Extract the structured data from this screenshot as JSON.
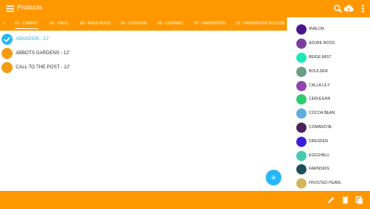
{
  "header": {
    "title": "Products"
  },
  "tabs": [
    {
      "label": "01 - CARPET",
      "active": true
    },
    {
      "label": "02 - VINYL"
    },
    {
      "label": "03 - AREA RUGS"
    },
    {
      "label": "04 - CUSHION"
    },
    {
      "label": "06 - CERAMIC"
    },
    {
      "label": "07 - HARDWOOD"
    },
    {
      "label": "07 - HARDWOOD ACCESS"
    }
  ],
  "products": [
    {
      "label": "ABANDON - 12'",
      "selected": true
    },
    {
      "label": "ABBOTS GARDENS - 12'"
    },
    {
      "label": "CALL TO THE POST - 12'"
    }
  ],
  "colors": [
    {
      "name": "AVALON",
      "hex": "#4a148c"
    },
    {
      "name": "AZURE MOSS",
      "hex": "#7b3fa0"
    },
    {
      "name": "BEIGE MIST",
      "hex": "#1de9b6"
    },
    {
      "name": "BOULDER",
      "hex": "#6b9e84"
    },
    {
      "name": "CALLA LILY",
      "hex": "#8e44ad"
    },
    {
      "name": "CERULEAN",
      "hex": "#2ecc71"
    },
    {
      "name": "COCOA BEAN",
      "hex": "#5dade2"
    },
    {
      "name": "COMANCHE",
      "hex": "#4a235a"
    },
    {
      "name": "DRESDEN",
      "hex": "#3a1fd8"
    },
    {
      "name": "EGGSHELL",
      "hex": "#48c9b0"
    },
    {
      "name": "FAWNSKIN",
      "hex": "#1f4e5f"
    },
    {
      "name": "FROSTED PEARL",
      "hex": "#d4b55b"
    }
  ],
  "fab": {
    "label": "+"
  },
  "theme": {
    "accent": "#ff9800",
    "selected": "#29b6f6",
    "dot": "#f39c12"
  }
}
